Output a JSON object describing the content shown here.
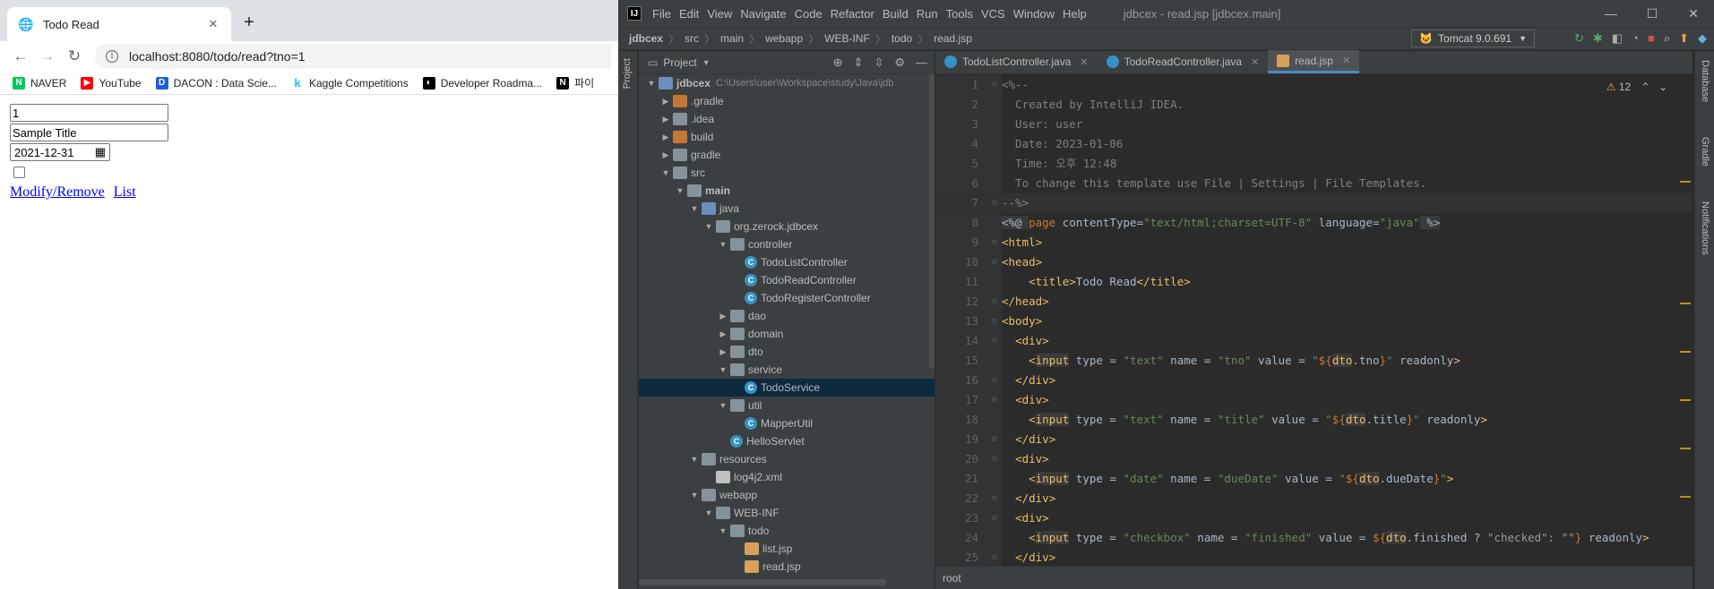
{
  "browser": {
    "tab_title": "Todo Read",
    "url": "localhost:8080/todo/read?tno=1",
    "bookmarks": [
      {
        "label": "NAVER",
        "icon": "naver-icon",
        "color": "#03c75a"
      },
      {
        "label": "YouTube",
        "icon": "youtube-icon",
        "color": "#ff0000"
      },
      {
        "label": "DACON : Data Scie...",
        "icon": "dacon-icon",
        "color": "#1a5fdc"
      },
      {
        "label": "Kaggle Competitions",
        "icon": "kaggle-icon",
        "color": "#20beff"
      },
      {
        "label": "Developer Roadma...",
        "icon": "roadmap-icon",
        "color": "#000000"
      },
      {
        "label": "파이",
        "icon": "notion-icon",
        "color": "#000000"
      }
    ],
    "form": {
      "tno": "1",
      "title": "Sample Title",
      "dueDate": "2021-12-31",
      "modify_link": "Modify/Remove",
      "list_link": "List"
    }
  },
  "ide": {
    "menu": [
      "File",
      "Edit",
      "View",
      "Navigate",
      "Code",
      "Refactor",
      "Build",
      "Run",
      "Tools",
      "VCS",
      "Window",
      "Help"
    ],
    "window_title": "jdbcex - read.jsp [jdbcex.main]",
    "breadcrumbs": [
      "jdbcex",
      "src",
      "main",
      "webapp",
      "WEB-INF",
      "todo",
      "read.jsp"
    ],
    "run_config": "Tomcat 9.0.691",
    "project_label": "Project",
    "side_left": "Project",
    "side_right": [
      "Database",
      "Gradle",
      "Notifications"
    ],
    "tree": [
      {
        "label": "jdbcex",
        "path": "C:\\Users\\user\\Workspace\\study\\Java\\jdb",
        "depth": 0,
        "icon": "bfolder",
        "arrow": "down",
        "bold": true
      },
      {
        "label": ".gradle",
        "depth": 1,
        "icon": "ofolder",
        "arrow": "right"
      },
      {
        "label": ".idea",
        "depth": 1,
        "icon": "folder",
        "arrow": "right"
      },
      {
        "label": "build",
        "depth": 1,
        "icon": "ofolder",
        "arrow": "right"
      },
      {
        "label": "gradle",
        "depth": 1,
        "icon": "folder",
        "arrow": "right"
      },
      {
        "label": "src",
        "depth": 1,
        "icon": "folder",
        "arrow": "down"
      },
      {
        "label": "main",
        "depth": 2,
        "icon": "folder",
        "arrow": "down",
        "bold": true
      },
      {
        "label": "java",
        "depth": 3,
        "icon": "bfolder",
        "arrow": "down"
      },
      {
        "label": "org.zerock.jdbcex",
        "depth": 4,
        "icon": "folder",
        "arrow": "down"
      },
      {
        "label": "controller",
        "depth": 5,
        "icon": "folder",
        "arrow": "down"
      },
      {
        "label": "TodoListController",
        "depth": 6,
        "icon": "cls",
        "arrow": ""
      },
      {
        "label": "TodoReadController",
        "depth": 6,
        "icon": "cls",
        "arrow": ""
      },
      {
        "label": "TodoRegisterController",
        "depth": 6,
        "icon": "cls",
        "arrow": ""
      },
      {
        "label": "dao",
        "depth": 5,
        "icon": "folder",
        "arrow": "right"
      },
      {
        "label": "domain",
        "depth": 5,
        "icon": "folder",
        "arrow": "right"
      },
      {
        "label": "dto",
        "depth": 5,
        "icon": "folder",
        "arrow": "right"
      },
      {
        "label": "service",
        "depth": 5,
        "icon": "folder",
        "arrow": "down"
      },
      {
        "label": "TodoService",
        "depth": 6,
        "icon": "cls",
        "arrow": "",
        "selected": true
      },
      {
        "label": "util",
        "depth": 5,
        "icon": "folder",
        "arrow": "down"
      },
      {
        "label": "MapperUtil",
        "depth": 6,
        "icon": "cls",
        "arrow": ""
      },
      {
        "label": "HelloServlet",
        "depth": 5,
        "icon": "cls",
        "arrow": ""
      },
      {
        "label": "resources",
        "depth": 3,
        "icon": "folder",
        "arrow": "down"
      },
      {
        "label": "log4j2.xml",
        "depth": 4,
        "icon": "file",
        "arrow": ""
      },
      {
        "label": "webapp",
        "depth": 3,
        "icon": "folder",
        "arrow": "down"
      },
      {
        "label": "WEB-INF",
        "depth": 4,
        "icon": "folder",
        "arrow": "down"
      },
      {
        "label": "todo",
        "depth": 5,
        "icon": "folder",
        "arrow": "down"
      },
      {
        "label": "list.jsp",
        "depth": 6,
        "icon": "jsp",
        "arrow": ""
      },
      {
        "label": "read.jsp",
        "depth": 6,
        "icon": "jsp",
        "arrow": ""
      }
    ],
    "tabs": [
      {
        "label": "TodoListController.java",
        "kind": "java"
      },
      {
        "label": "TodoReadController.java",
        "kind": "java"
      },
      {
        "label": "read.jsp",
        "kind": "jsp",
        "active": true
      }
    ],
    "warnings": "12",
    "status": "root",
    "code_lines": [
      {
        "n": "1",
        "segs": [
          [
            "com",
            "<%--"
          ]
        ]
      },
      {
        "n": "2",
        "segs": [
          [
            "com",
            "  Created by IntelliJ IDEA."
          ]
        ]
      },
      {
        "n": "3",
        "segs": [
          [
            "com",
            "  User: user"
          ]
        ]
      },
      {
        "n": "4",
        "segs": [
          [
            "com",
            "  Date: 2023-01-06"
          ]
        ]
      },
      {
        "n": "5",
        "segs": [
          [
            "com",
            "  Time: 오후 12:48"
          ]
        ]
      },
      {
        "n": "6",
        "segs": [
          [
            "com",
            "  To change this template use File | Settings | File Templates."
          ]
        ]
      },
      {
        "n": "7",
        "segs": [
          [
            "com",
            "--%>"
          ]
        ],
        "cur": true
      },
      {
        "n": "8",
        "segs": [
          [
            "el",
            "<%@ "
          ],
          [
            "kw",
            "page "
          ],
          [
            "id",
            "contentType="
          ],
          [
            "str",
            "\"text/html;charset=UTF-8\""
          ],
          [
            "id",
            " language="
          ],
          [
            "str",
            "\"java\""
          ],
          [
            "el",
            " %>"
          ]
        ]
      },
      {
        "n": "9",
        "segs": [
          [
            "tag",
            "<html>"
          ]
        ]
      },
      {
        "n": "10",
        "segs": [
          [
            "tag",
            "<head>"
          ]
        ]
      },
      {
        "n": "11",
        "segs": [
          [
            "id",
            "    "
          ],
          [
            "tag",
            "<title>"
          ],
          [
            "id",
            "Todo Read"
          ],
          [
            "tag",
            "</title>"
          ]
        ]
      },
      {
        "n": "12",
        "segs": [
          [
            "tag",
            "</head>"
          ]
        ]
      },
      {
        "n": "13",
        "segs": [
          [
            "tag",
            "<body>"
          ]
        ]
      },
      {
        "n": "14",
        "segs": [
          [
            "id",
            "  "
          ],
          [
            "tag",
            "<div>"
          ]
        ]
      },
      {
        "n": "15",
        "segs": [
          [
            "id",
            "    "
          ],
          [
            "tag",
            "<"
          ],
          [
            "hl",
            "input"
          ],
          [
            "id",
            " type = "
          ],
          [
            "str",
            "\"text\""
          ],
          [
            "id",
            " name = "
          ],
          [
            "str",
            "\"tno\""
          ],
          [
            "id",
            " value = "
          ],
          [
            "str",
            "\""
          ],
          [
            "kw",
            "${"
          ],
          [
            "hl",
            "dto"
          ],
          [
            "id",
            ".tno"
          ],
          [
            "kw",
            "}"
          ],
          [
            "str",
            "\""
          ],
          [
            "id",
            " readonly"
          ],
          [
            "tag",
            ">"
          ]
        ]
      },
      {
        "n": "16",
        "segs": [
          [
            "id",
            "  "
          ],
          [
            "tag",
            "</div>"
          ]
        ]
      },
      {
        "n": "17",
        "segs": [
          [
            "id",
            "  "
          ],
          [
            "tag",
            "<div>"
          ]
        ]
      },
      {
        "n": "18",
        "segs": [
          [
            "id",
            "    "
          ],
          [
            "tag",
            "<"
          ],
          [
            "hl",
            "input"
          ],
          [
            "id",
            " type = "
          ],
          [
            "str",
            "\"text\""
          ],
          [
            "id",
            " name = "
          ],
          [
            "str",
            "\"title\""
          ],
          [
            "id",
            " value = "
          ],
          [
            "str",
            "\""
          ],
          [
            "kw",
            "${"
          ],
          [
            "hl",
            "dto"
          ],
          [
            "id",
            ".title"
          ],
          [
            "kw",
            "}"
          ],
          [
            "str",
            "\""
          ],
          [
            "id",
            " readonly"
          ],
          [
            "tag",
            ">"
          ]
        ]
      },
      {
        "n": "19",
        "segs": [
          [
            "id",
            "  "
          ],
          [
            "tag",
            "</div>"
          ]
        ]
      },
      {
        "n": "20",
        "segs": [
          [
            "id",
            "  "
          ],
          [
            "tag",
            "<div>"
          ]
        ]
      },
      {
        "n": "21",
        "segs": [
          [
            "id",
            "    "
          ],
          [
            "tag",
            "<"
          ],
          [
            "hl",
            "input"
          ],
          [
            "id",
            " type = "
          ],
          [
            "str",
            "\"date\""
          ],
          [
            "id",
            " name = "
          ],
          [
            "str",
            "\"dueDate\""
          ],
          [
            "id",
            " value = "
          ],
          [
            "str",
            "\""
          ],
          [
            "kw",
            "${"
          ],
          [
            "hl",
            "dto"
          ],
          [
            "id",
            ".dueDate"
          ],
          [
            "kw",
            "}"
          ],
          [
            "str",
            "\""
          ],
          [
            "tag",
            ">"
          ]
        ]
      },
      {
        "n": "22",
        "segs": [
          [
            "id",
            "  "
          ],
          [
            "tag",
            "</div>"
          ]
        ]
      },
      {
        "n": "23",
        "segs": [
          [
            "id",
            "  "
          ],
          [
            "tag",
            "<div>"
          ]
        ]
      },
      {
        "n": "24",
        "segs": [
          [
            "id",
            "    "
          ],
          [
            "tag",
            "<"
          ],
          [
            "hl",
            "input"
          ],
          [
            "id",
            " type = "
          ],
          [
            "str",
            "\"checkbox\""
          ],
          [
            "id",
            " name = "
          ],
          [
            "str",
            "\"finished\""
          ],
          [
            "id",
            " value = "
          ],
          [
            "kw",
            "${"
          ],
          [
            "hl",
            "dto"
          ],
          [
            "id",
            ".finished ? "
          ],
          [
            "dim",
            "\"checked\": \"\""
          ],
          [
            "kw",
            "}"
          ],
          [
            "id",
            " readonly"
          ],
          [
            "tag",
            ">"
          ]
        ]
      },
      {
        "n": "25",
        "segs": [
          [
            "id",
            "  "
          ],
          [
            "tag",
            "</div>"
          ]
        ]
      }
    ]
  }
}
